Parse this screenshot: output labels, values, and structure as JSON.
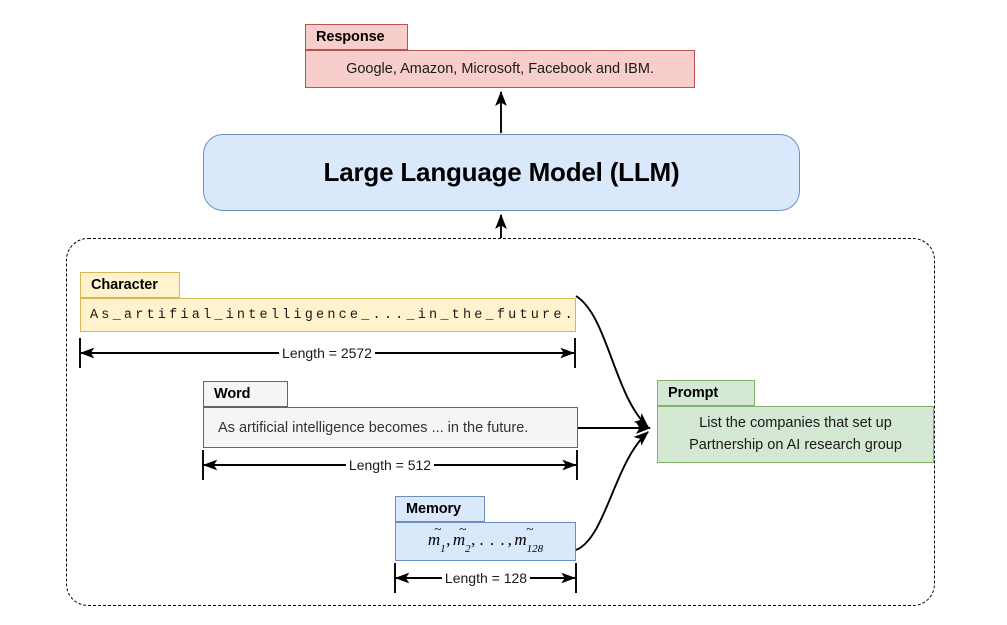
{
  "diagram": {
    "title": "LLM prompt composition from character, word and memory representations",
    "colors": {
      "response_fill": "#f8cecc",
      "response_stroke": "#b85450",
      "llm_fill": "#dae8fc",
      "llm_stroke": "#6c8ebf",
      "character_fill": "#fff2cc",
      "character_stroke": "#d6b656",
      "word_fill": "#f5f5f5",
      "word_stroke": "#666666",
      "memory_fill": "#dae8fc",
      "memory_stroke": "#6c8ebf",
      "prompt_fill": "#d5e8d4",
      "prompt_stroke": "#82b366",
      "arrow": "#000000",
      "group_border": "#000000"
    }
  },
  "response": {
    "tab_label": "Response",
    "text": "Google, Amazon, Microsoft, Facebook and IBM."
  },
  "llm": {
    "label": "Large Language Model (LLM)"
  },
  "character": {
    "tab_label": "Character",
    "text": "As_artifial_intelligence_..._in_the_future.",
    "length_label": "Length = 2572"
  },
  "word": {
    "tab_label": "Word",
    "text": "As artificial intelligence becomes ... in the future.",
    "length_label": "Length = 512"
  },
  "memory": {
    "tab_label": "Memory",
    "math": {
      "var": "m",
      "tilde": "~",
      "items": [
        "1",
        "2",
        "128"
      ],
      "comma": ",",
      "ellipsis": ". . ."
    },
    "text": "m̃1, m̃2, . . . , m̃128",
    "length_label": "Length = 128"
  },
  "prompt": {
    "tab_label": "Prompt",
    "line1": "List the companies that set up",
    "line2": "Partnership on AI research group"
  }
}
